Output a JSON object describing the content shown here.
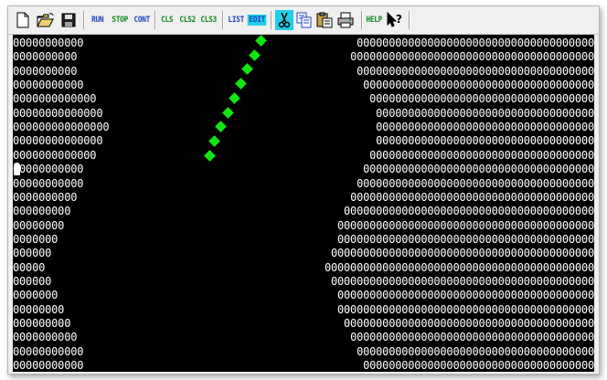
{
  "toolbar": {
    "run": "RUN",
    "stop": "STOP",
    "cont": "CONT",
    "cls": "CLS",
    "cls2": "CLS2",
    "cls3": "CLS3",
    "list": "LIST",
    "edit": "EDIT",
    "help": "HELP"
  },
  "colors": {
    "canvas_bg": "#000000",
    "text": "#ffffff",
    "snake": "#12e612",
    "edit_highlight": "#20d0e8",
    "blue_label": "#1f3fbf",
    "green_label": "#0c8a1c"
  },
  "icons": [
    "new-file-icon",
    "open-folder-icon",
    "save-disk-icon",
    "cut-scissors-icon",
    "copy-icon",
    "paste-icon",
    "print-icon",
    "whats-this-help-icon"
  ],
  "screen": {
    "rows": [
      {
        "left": "00000000000",
        "right": "0000000000000000000000000000000000000"
      },
      {
        "left": "0000000000",
        "right": "00000000000000000000000000000000000000"
      },
      {
        "left": "0000000000",
        "right": "0000000000000000000000000000000000000"
      },
      {
        "left": "00000000000",
        "right": "000000000000000000000000000000000000"
      },
      {
        "left": "0000000000000",
        "right": "00000000000000000000000000000000000"
      },
      {
        "left": "00000000000000",
        "right": "0000000000000000000000000000000000"
      },
      {
        "left": "000000000000000",
        "right": "0000000000000000000000000000000000"
      },
      {
        "left": "00000000000000",
        "right": "0000000000000000000000000000000000"
      },
      {
        "left": "0000000000000",
        "right": "00000000000000000000000000000000000"
      },
      {
        "left": "00000000000",
        "right": "000000000000000000000000000000000000"
      },
      {
        "left": "00000000000",
        "right": "0000000000000000000000000000000000000"
      },
      {
        "left": "0000000000",
        "right": "00000000000000000000000000000000000000"
      },
      {
        "left": "000000000",
        "right": "000000000000000000000000000000000000000"
      },
      {
        "left": "00000000",
        "right": "0000000000000000000000000000000000000000"
      },
      {
        "left": "0000000",
        "right": "0000000000000000000000000000000000000000"
      },
      {
        "left": "000000",
        "right": "00000000000000000000000000000000000000000"
      },
      {
        "left": "00000",
        "right": "000000000000000000000000000000000000000000"
      },
      {
        "left": "000000",
        "right": "00000000000000000000000000000000000000000"
      },
      {
        "left": "0000000",
        "right": "0000000000000000000000000000000000000000"
      },
      {
        "left": "00000000",
        "right": "0000000000000000000000000000000000000000"
      },
      {
        "left": "000000000",
        "right": "000000000000000000000000000000000000000"
      },
      {
        "left": "0000000000",
        "right": "00000000000000000000000000000000000000"
      },
      {
        "left": "00000000000",
        "right": "0000000000000000000000000000000000000"
      },
      {
        "left": "00000000000",
        "right": "000000000000000000000000000000000000"
      }
    ],
    "snake_length": 9
  }
}
